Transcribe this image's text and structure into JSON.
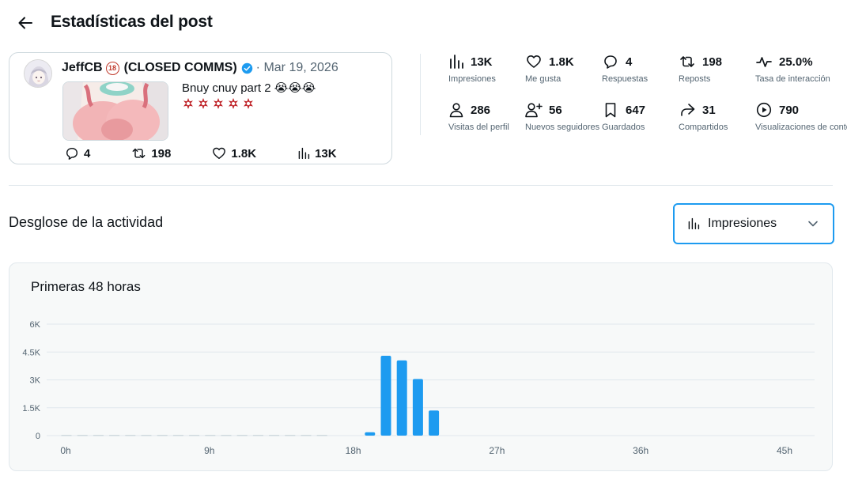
{
  "header": {
    "title": "Estadísticas del post",
    "back_icon": "arrow-left-icon"
  },
  "post": {
    "author_name": "JeffCB",
    "age_badge": "18",
    "author_suffix": "(CLOSED COMMS)",
    "date": "· Mar 19, 2026",
    "text": "Bnuy cnuy part 2 😭😭😭",
    "anger_count": 5,
    "stats": {
      "replies": "4",
      "reposts": "198",
      "likes": "1.8K",
      "views": "13K"
    }
  },
  "metrics": [
    {
      "icon": "bar-chart-icon",
      "value": "13K",
      "label": "Impresiones"
    },
    {
      "icon": "heart-icon",
      "value": "1.8K",
      "label": "Me gusta"
    },
    {
      "icon": "reply-icon",
      "value": "4",
      "label": "Respuestas"
    },
    {
      "icon": "repost-icon",
      "value": "198",
      "label": "Reposts"
    },
    {
      "icon": "pulse-icon",
      "value": "25.0%",
      "label": "Tasa de interacción"
    },
    {
      "icon": "person-icon",
      "value": "286",
      "label": "Visitas del perfil"
    },
    {
      "icon": "person-add-icon",
      "value": "56",
      "label": "Nuevos seguidores"
    },
    {
      "icon": "bookmark-icon",
      "value": "647",
      "label": "Guardados"
    },
    {
      "icon": "share-icon",
      "value": "31",
      "label": "Compartidos"
    },
    {
      "icon": "play-icon",
      "value": "790",
      "label": "Visualizaciones de contenido multimedia"
    }
  ],
  "activity": {
    "title": "Desglose de la actividad",
    "dropdown_value": "Impresiones"
  },
  "chart_data": {
    "type": "bar",
    "title": "Primeras 48 horas",
    "xlabel": "",
    "ylabel": "",
    "ylim": [
      0,
      6000
    ],
    "y_ticks": [
      "0",
      "1.5K",
      "3K",
      "4.5K",
      "6K"
    ],
    "x_ticks": [
      "0h",
      "9h",
      "18h",
      "27h",
      "36h",
      "45h"
    ],
    "grid": true,
    "color": "#1d9bf0",
    "placeholder_color": "#cfd9de",
    "categories": [
      "0h",
      "1h",
      "2h",
      "3h",
      "4h",
      "5h",
      "6h",
      "7h",
      "8h",
      "9h",
      "10h",
      "11h",
      "12h",
      "13h",
      "14h",
      "15h",
      "16h",
      "17h",
      "18h",
      "19h",
      "20h",
      "21h",
      "22h",
      "23h"
    ],
    "values": [
      0,
      0,
      0,
      0,
      0,
      0,
      0,
      0,
      0,
      0,
      0,
      0,
      0,
      0,
      0,
      0,
      0,
      0,
      0,
      180,
      4300,
      4050,
      3050,
      1350
    ]
  }
}
